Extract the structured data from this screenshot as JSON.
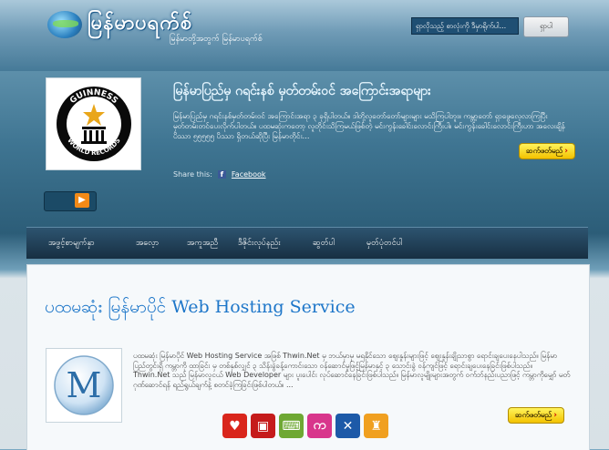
{
  "header": {
    "site_name": "မြန်မာပရက်စ်",
    "tagline": "မြန်မာတို့အတွက် မြန်မာပရက်စ်",
    "search_placeholder": "ရှာလိုသည့် စာလုံးကို ဒီမှာရိုက်ပါ...",
    "search_button": "ရှာပါ"
  },
  "featured": {
    "logo_text_top": "GUINNESS",
    "logo_text_bottom": "WORLD RECORDS",
    "title": "မြန်မာပြည်မှ ဂရင်းနစ် မှတ်တမ်းဝင် အကြောင်းအရာများ",
    "body": "မြန်မာပြည်မှ ဂရင်းနစ်မှတ်တမ်းဝင် အကြောင်းအရာ ၃ ခုရှိပါတယ်။ ဒါတို့လူတော်တော်များများ မသိကြပါဘူး။ ကမ္ဘာ့တော် ရှာဖွေလေ့လာကြပြီး မှတ်တမ်းတင်ပေးလိုက်ပါတယ်။ ပထမဆုံးကတော့ လူတိုင်းသိကြမယ်ဖြစ်တဲ့ မင်းကွန်းခေါင်းလောင်းကြီးပါ။ မင်းကွန်းခေါင်းလောင်းကြီးဟာ အလေးချိန် ပိဿာ ၅၅၅၅၅ ပိဿာ ရှိတယ်ဆိုပြီး မြန်မာတိုင်း...",
    "share_label": "Share this:",
    "facebook_label": "Facebook",
    "read_more": "ဆက်ဖတ်မည်"
  },
  "nav": {
    "items": [
      "အဖွင့်စာမျက်နှာ",
      "အလေ့ာ",
      "အကူအညီ",
      "ဒီဇိုင်းလုပ်နည်း",
      "ဆွတ်ပါ",
      "မှတ်ပုံတင်ပါ"
    ]
  },
  "post": {
    "title": "ပထမဆုံး မြန်မာပိုင် Web Hosting Service",
    "thumb_letter": "M",
    "body": "ပထမဆုံး မြန်မာပိုင် Web Hosting Service အဖြစ် Thwin.Net မှ ဘယ်မှာမှ မရနိုင်သော ဈေးနှုန်းများဖြင့် ဈေးနှုန်းချိုသာစွာ ရောင်းချပေးနေပါသည်။ မြန်မာပြည်တွင်းရှိ ကမ္ဘာကို ထာခြင်း မှ တစ်နှစ်လျှင် ၃ သိန်းခွဲခန့်ကောင်းသော ဝန်ဆောင်မှုဖြင့်မြန်မာနှင့် ၃ သောင်းခွဲ ဝန်ကျင်ဖြင့် ရောင်းချပေးနေခြင်းဖြစ်ပါသည်။ Thwin.Net သည် မြန်မာလူငယ် Web Developer များ ပူးပေါင်း လုပ်ဆောင်နေခြင်းဖြစ်ပါသည်။ မြန်မာလူမျိုးများအတွက် ဝက်ဘ်နည်းပညာဖြင့် ကမ္ဘာကိုမျှော် မတ်ဂုဏ်ဆောင်ရန် ရည်ရွယ်ချက်နဲ့ စတင်ခဲ့ကြခြင်းဖြစ်ပါတယ်။ ...",
    "read_more": "ဆက်ဖတ်မည်",
    "icons": [
      {
        "name": "person-heart-icon",
        "color": "#d9261c",
        "glyph": "♥"
      },
      {
        "name": "bus-icon",
        "color": "#c51b1b",
        "glyph": "▣"
      },
      {
        "name": "keyboard-icon",
        "color": "#6ea833",
        "glyph": "⌨"
      },
      {
        "name": "myanmar-ka-icon",
        "color": "#d8368c",
        "glyph": "က"
      },
      {
        "name": "people-key-icon",
        "color": "#1d5aa8",
        "glyph": "✕"
      },
      {
        "name": "runner-icon",
        "color": "#f0a020",
        "glyph": "♜"
      }
    ]
  }
}
